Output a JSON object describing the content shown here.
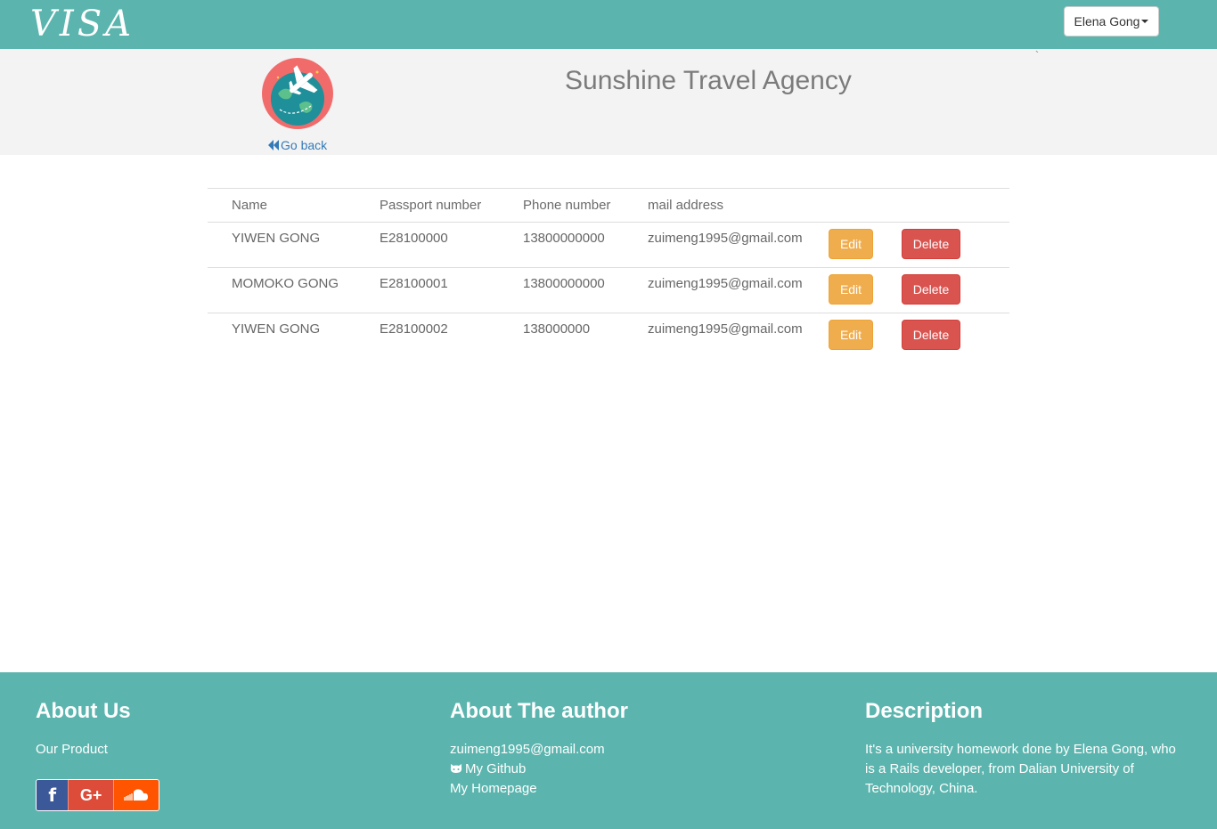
{
  "navbar": {
    "brand": "VISA",
    "user_menu_label": "Elena Gong"
  },
  "header": {
    "go_back": "Go back",
    "agency_title": "Sunshine Travel Agency",
    "tick": "`"
  },
  "table": {
    "headers": [
      "Name",
      "Passport number",
      "Phone number",
      "mail address"
    ],
    "rows": [
      {
        "name": "YIWEN GONG",
        "passport": "E28100000",
        "phone": "13800000000",
        "mail": "zuimeng1995@gmail.com"
      },
      {
        "name": "MOMOKO GONG",
        "passport": "E28100001",
        "phone": "13800000000",
        "mail": "zuimeng1995@gmail.com"
      },
      {
        "name": "YIWEN GONG",
        "passport": "E28100002",
        "phone": "138000000",
        "mail": "zuimeng1995@gmail.com"
      }
    ],
    "edit_label": "Edit",
    "delete_label": "Delete"
  },
  "footer": {
    "about_us": {
      "title": "About Us",
      "product": "Our Product"
    },
    "social": {
      "facebook": "f",
      "google_plus": "G+",
      "icons": [
        "facebook-icon",
        "google-plus-icon",
        "soundcloud-icon"
      ]
    },
    "author": {
      "title": "About The author",
      "email": "zuimeng1995@gmail.com",
      "github": "My Github",
      "homepage": "My Homepage"
    },
    "description": {
      "title": "Description",
      "text": "It's a university homework done by Elena Gong, who is a Rails developer, from Dalian University of Technology, China."
    }
  },
  "colors": {
    "navbar": "#5bb5ae",
    "header_band": "#f3f3f3",
    "edit_button": "#f0ad4e",
    "delete_button": "#d9534f",
    "link": "#337ab7"
  }
}
